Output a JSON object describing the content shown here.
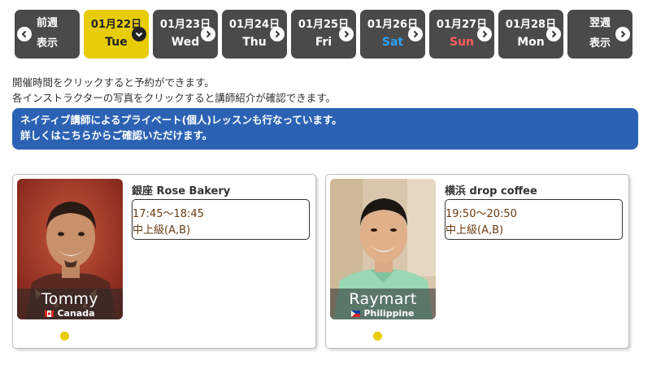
{
  "daynav": {
    "prev": {
      "line1": "前週",
      "line2": "表示"
    },
    "days": [
      {
        "date": "01月22日",
        "dow": "Tue",
        "active": true,
        "type": "weekday"
      },
      {
        "date": "01月23日",
        "dow": "Wed",
        "active": false,
        "type": "weekday"
      },
      {
        "date": "01月24日",
        "dow": "Thu",
        "active": false,
        "type": "weekday"
      },
      {
        "date": "01月25日",
        "dow": "Fri",
        "active": false,
        "type": "weekday"
      },
      {
        "date": "01月26日",
        "dow": "Sat",
        "active": false,
        "type": "sat"
      },
      {
        "date": "01月27日",
        "dow": "Sun",
        "active": false,
        "type": "sun"
      },
      {
        "date": "01月28日",
        "dow": "Mon",
        "active": false,
        "type": "weekday"
      }
    ],
    "next": {
      "line1": "翌週",
      "line2": "表示"
    }
  },
  "info": {
    "line1": "開催時間をクリックすると予約ができます。",
    "line2": "各インストラクターの写真をクリックすると講師紹介が確認できます。"
  },
  "notice": {
    "line1": "ネイティブ講師によるプライベート(個人)レッスンも行なっています。",
    "line2": "詳しくはこちらからご確認いただけます。"
  },
  "lessons": [
    {
      "instructor": "Tommy",
      "country": "Canada",
      "studio": "銀座 Rose Bakery",
      "time": "17:45〜18:45",
      "level": "中上級(A,B)"
    },
    {
      "instructor": "Raymart",
      "country": "Philippine",
      "studio": "横浜 drop coffee",
      "time": "19:50〜20:50",
      "level": "中上級(A,B)"
    }
  ],
  "colors": {
    "dark_button": "#4a4a4a",
    "active_button": "#e8cc06",
    "notice_bg": "#2c62b4",
    "saturday": "#29a3ff",
    "sunday": "#ff5a5a",
    "level_dot": "#e8cc06"
  }
}
